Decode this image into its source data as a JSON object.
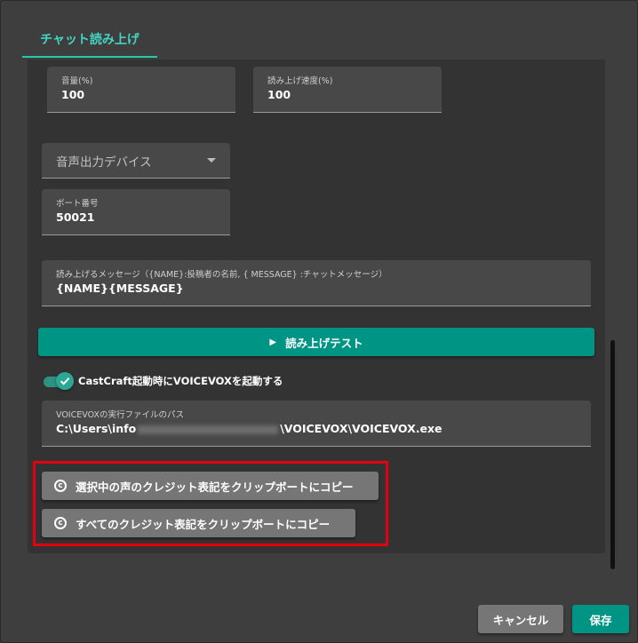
{
  "tabs": [
    {
      "label": "チャット読み上げ",
      "active": true
    }
  ],
  "fields": {
    "volume": {
      "label": "音量(%)",
      "value": "100"
    },
    "speed": {
      "label": "読み上げ速度(%)",
      "value": "100"
    },
    "audio_device": {
      "placeholder": "音声出力デバイス"
    },
    "port": {
      "label": "ポート番号",
      "value": "50021"
    },
    "message": {
      "label": "読み上げるメッセージ（{NAME}:投稿者の名前, { MESSAGE} :チャットメッセージ）",
      "value": "{NAME}{MESSAGE}"
    },
    "exe_path": {
      "label": "VOICEVOXの実行ファイルのパス",
      "value_prefix": "C:\\Users\\info",
      "value_suffix": "\\VOICEVOX\\VOICEVOX.exe"
    }
  },
  "test_button": {
    "icon": "play-icon",
    "label": "読み上げテスト"
  },
  "toggle": {
    "label": "CastCraft起動時にVOICEVOXを起動する",
    "checked": true
  },
  "copy_buttons": {
    "selected": {
      "icon": "copyright-icon",
      "label": "選択中の声のクレジット表記をクリップボートにコピー"
    },
    "all": {
      "icon": "copyright-icon",
      "label": "すべてのクレジット表記をクリップボートにコピー"
    }
  },
  "footer": {
    "cancel_label": "キャンセル",
    "save_label": "保存"
  },
  "colors": {
    "accent": "#009485",
    "tab_text": "#44d3c0",
    "highlight": "#e3000f",
    "secondary_button": "#767676"
  }
}
